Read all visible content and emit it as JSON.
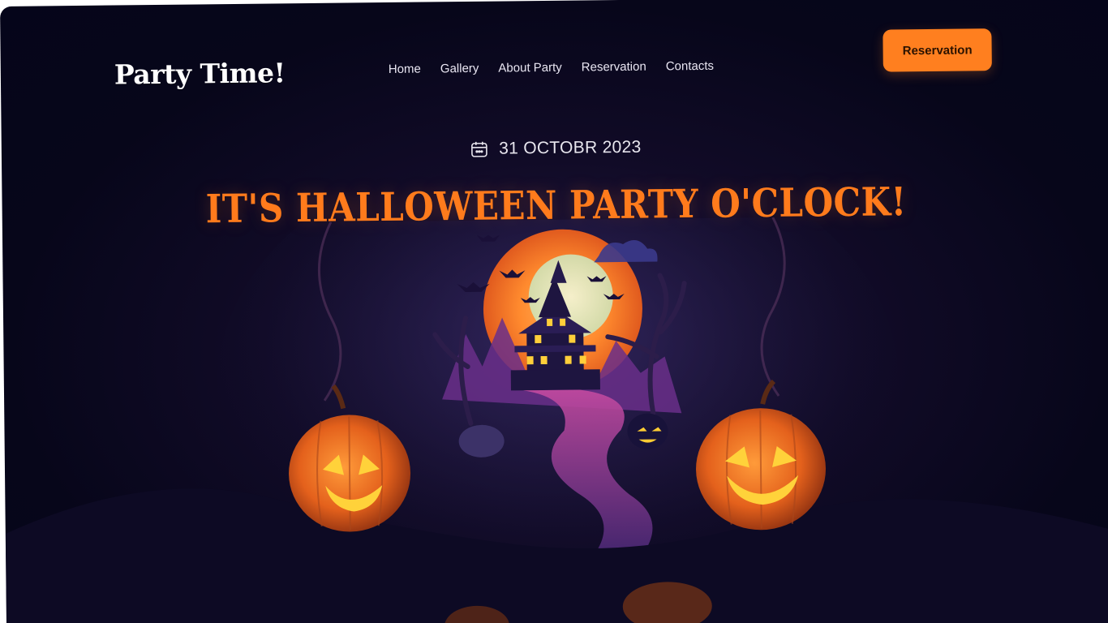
{
  "header": {
    "logo": "Party Time!",
    "nav": [
      "Home",
      "Gallery",
      "About Party",
      "Reservation",
      "Contacts"
    ],
    "cta_label": "Reservation"
  },
  "hero": {
    "date": "31 OCTOBR 2023",
    "date_icon": "calendar-icon",
    "title": "IT'S HALLOWEEN PARTY O'CLOCK!",
    "illustration": "haunted-house-pumpkins-illustration"
  },
  "colors": {
    "accent": "#ff7f1f",
    "background": "#07061a",
    "title": "#ff7b1c",
    "text": "#e9e6f2"
  }
}
